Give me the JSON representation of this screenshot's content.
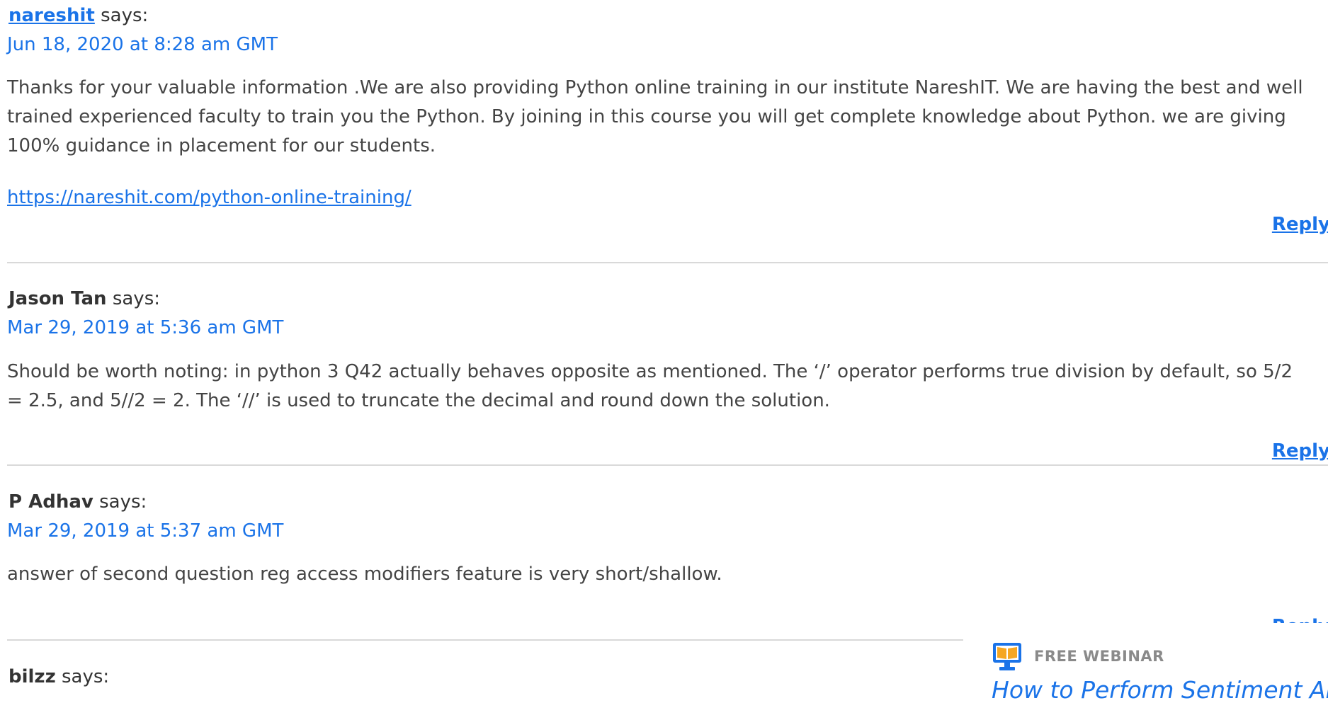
{
  "comments": [
    {
      "author": "nareshit",
      "says": "says:",
      "date": "Jun 18, 2020 at 8:28 am GMT",
      "body": [
        "Thanks for your valuable information .We are also providing Python online training in our institute NareshIT. We are having the best and well trained experienced faculty to train you the Python. By joining in this course you will get complete knowledge about Python. we are giving 100% guidance in placement for our students."
      ],
      "url": "https://nareshit.com/python-online-training/",
      "reply_label": "Reply"
    },
    {
      "author": "Jason Tan",
      "says": "says:",
      "date": "Mar 29, 2019 at 5:36 am GMT",
      "body": [
        "Should be worth noting: in python 3 Q42 actually behaves opposite as mentioned. The ‘/’ operator performs true division by default, so 5/2 = 2.5, and 5//2 = 2. The ‘//’ is used to truncate the decimal and round down the solution."
      ],
      "reply_label": "Reply"
    },
    {
      "author": "P Adhav",
      "says": "says:",
      "date": "Mar 29, 2019 at 5:37 am GMT",
      "body": [
        "answer of second question reg access modifiers feature is very short/shallow."
      ],
      "reply_label": "Reply"
    },
    {
      "author": "bilzz",
      "says": "says:"
    }
  ],
  "webinar": {
    "label": "FREE WEBINAR",
    "title": "How to Perform Sentiment Analy",
    "icon": "book-monitor-icon"
  },
  "colors": {
    "link": "#1a73e8",
    "text": "#444444",
    "divider": "#d9d9d9",
    "icon_blue": "#1a73e8",
    "icon_orange": "#f5a623"
  }
}
